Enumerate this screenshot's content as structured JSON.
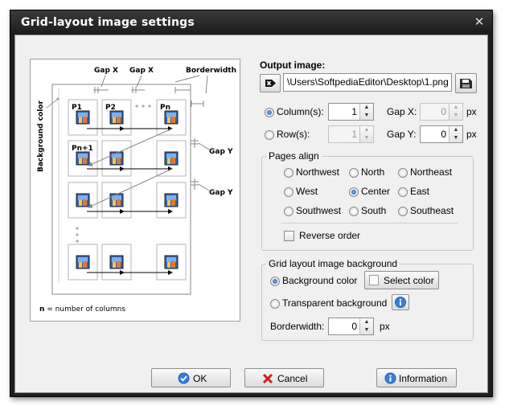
{
  "window": {
    "title": "Grid-layout image settings",
    "close_glyph": "✕"
  },
  "illustration": {
    "side_label": "Background color",
    "gap_x_1": "Gap X",
    "gap_x_2": "Gap X",
    "borderwidth": "Borderwidth",
    "gap_y_1": "Gap Y",
    "gap_y_2": "Gap Y",
    "p1": "P1",
    "p2": "P2",
    "pn": "Pn",
    "pn1": "Pn+1",
    "footnote_n": "n",
    "footnote_rest": " = number of columns"
  },
  "output": {
    "label": "Output image:",
    "path": "\\Users\\SoftpediaEditor\\Desktop\\1.png",
    "browse_icon": "arrow-icon",
    "save_icon": "save-icon"
  },
  "columns": {
    "label": "Column(s):",
    "value": "1",
    "selected": true
  },
  "rows": {
    "label": "Row(s):",
    "value": "1",
    "selected": false
  },
  "gap_x": {
    "label": "Gap X:",
    "value": "0",
    "unit": "px"
  },
  "gap_y": {
    "label": "Gap Y:",
    "value": "0",
    "unit": "px"
  },
  "pages_align": {
    "title": "Pages align",
    "options": [
      "Northwest",
      "North",
      "Northeast",
      "West",
      "Center",
      "East",
      "Southwest",
      "South",
      "Southeast"
    ],
    "selected": "Center",
    "reverse_order": "Reverse order"
  },
  "background": {
    "title": "Grid layout image background",
    "background_color": "Background color",
    "select_color": "Select color",
    "transparent": "Transparent background",
    "borderwidth_label": "Borderwidth:",
    "borderwidth_value": "0",
    "borderwidth_unit": "px",
    "selected": "Background color"
  },
  "buttons": {
    "ok": "OK",
    "cancel": "Cancel",
    "information": "Information"
  },
  "colors": {
    "title_bar": "#1c1c1c",
    "client": "#f0f0f0",
    "accent": "#1d5fb8",
    "cancel_x": "#d01c1c"
  }
}
